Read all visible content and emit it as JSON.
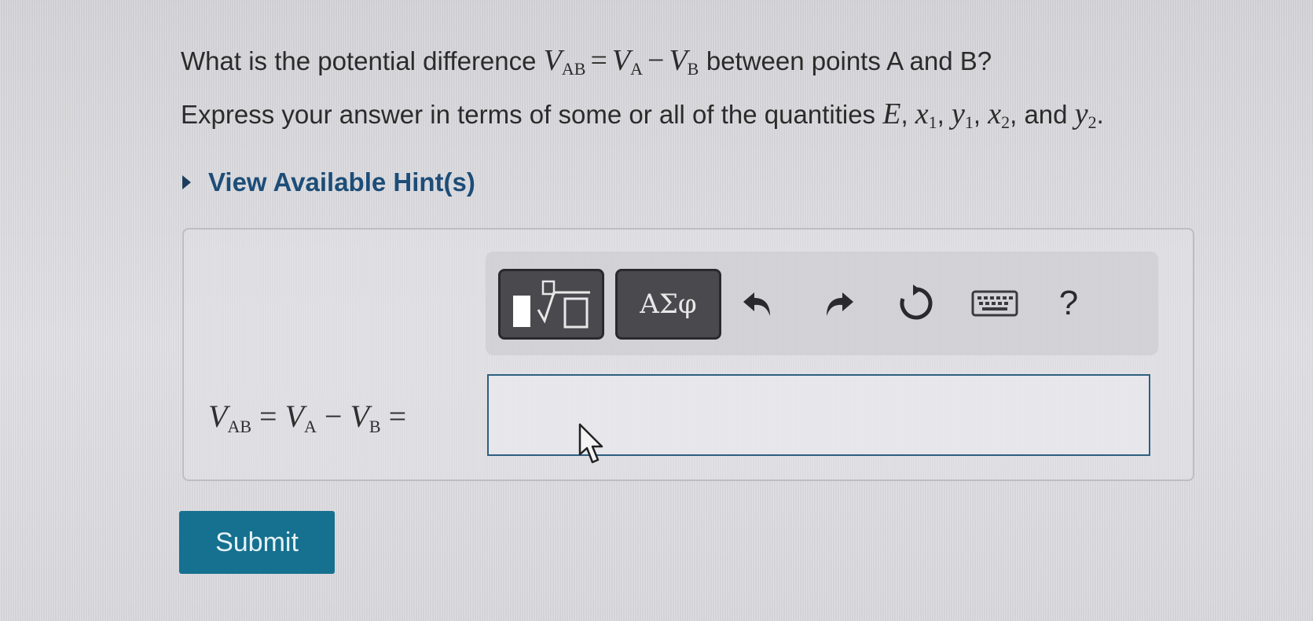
{
  "question": {
    "line1_prefix": "What is the potential difference ",
    "line1_suffix": " between points A and B?",
    "line2_prefix": "Express your answer in terms of some or all of the quantities ",
    "line2_and": ", and ",
    "line2_period": ".",
    "var_V": "V",
    "sub_AB": "AB",
    "sub_A": "A",
    "sub_B": "B",
    "equals": "=",
    "minus": "−",
    "quantities": [
      "E",
      "x",
      "y",
      "x",
      "y"
    ],
    "quantity_subs": [
      "",
      "1",
      "1",
      "2",
      "2"
    ],
    "comma": ", "
  },
  "hint": {
    "label": "View Available Hint(s)"
  },
  "toolbar": {
    "template_icon": "templates-icon",
    "greek_label": "ΑΣφ",
    "help_label": "?",
    "icons": [
      "undo-icon",
      "redo-icon",
      "reset-icon",
      "keyboard-icon",
      "help-icon"
    ]
  },
  "answer": {
    "value": ""
  },
  "submit": {
    "label": "Submit",
    "color": "#16708f"
  }
}
